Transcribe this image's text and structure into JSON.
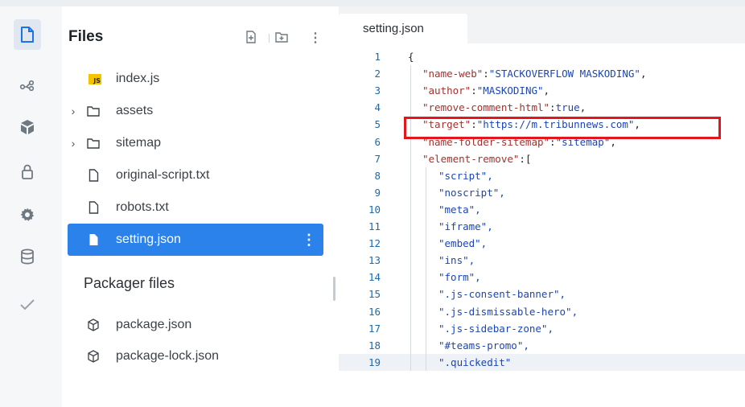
{
  "sidebar": {
    "title": "Files",
    "files": [
      {
        "name": "index.js",
        "icon": "js-file-icon",
        "type": "file"
      },
      {
        "name": "assets",
        "icon": "folder-icon",
        "type": "folder"
      },
      {
        "name": "sitemap",
        "icon": "folder-icon",
        "type": "folder"
      },
      {
        "name": "original-script.txt",
        "icon": "file-icon",
        "type": "file"
      },
      {
        "name": "robots.txt",
        "icon": "file-icon",
        "type": "file"
      },
      {
        "name": "setting.json",
        "icon": "file-icon",
        "type": "file",
        "selected": true
      }
    ],
    "packager_title": "Packager files",
    "packager_files": [
      {
        "name": "package.json",
        "icon": "package-icon"
      },
      {
        "name": "package-lock.json",
        "icon": "package-icon"
      }
    ]
  },
  "editor": {
    "tab_label": "setting.json",
    "current_line": 19,
    "lines": [
      {
        "n": "1",
        "t": "{"
      },
      {
        "n": "2",
        "k": "\"name-web\"",
        "v": "\"STACKOVERFLOW MASKODING\"",
        "end": ","
      },
      {
        "n": "3",
        "k": "\"author\"",
        "v": "\"MASKODING\"",
        "end": ","
      },
      {
        "n": "4",
        "k": "\"remove-comment-html\"",
        "v": "true",
        "end": ","
      },
      {
        "n": "5",
        "k": "\"target\"",
        "v": "\"https://m.tribunnews.com\"",
        "end": ","
      },
      {
        "n": "6",
        "k": "\"name-folder-sitemap\"",
        "v": "\"sitemap\"",
        "end": ","
      },
      {
        "n": "7",
        "k": "\"element-remove\"",
        "v": "[",
        "end": ""
      },
      {
        "n": "8",
        "t": "\"script\","
      },
      {
        "n": "9",
        "t": "\"noscript\","
      },
      {
        "n": "10",
        "t": "\"meta\","
      },
      {
        "n": "11",
        "t": "\"iframe\","
      },
      {
        "n": "12",
        "t": "\"embed\","
      },
      {
        "n": "13",
        "t": "\"ins\","
      },
      {
        "n": "14",
        "t": "\"form\","
      },
      {
        "n": "15",
        "t": "\".js-consent-banner\","
      },
      {
        "n": "16",
        "t": "\".js-dismissable-hero\","
      },
      {
        "n": "17",
        "t": "\".js-sidebar-zone\","
      },
      {
        "n": "18",
        "t": "\"#teams-promo\","
      },
      {
        "n": "19",
        "t": "\".quickedit\""
      }
    ]
  },
  "colors": {
    "accent": "#2b82ea",
    "highlight_box": "#e3161d",
    "json_key": "#a3312e",
    "json_value": "#1b46b4",
    "line_number": "#1e6aa8"
  }
}
